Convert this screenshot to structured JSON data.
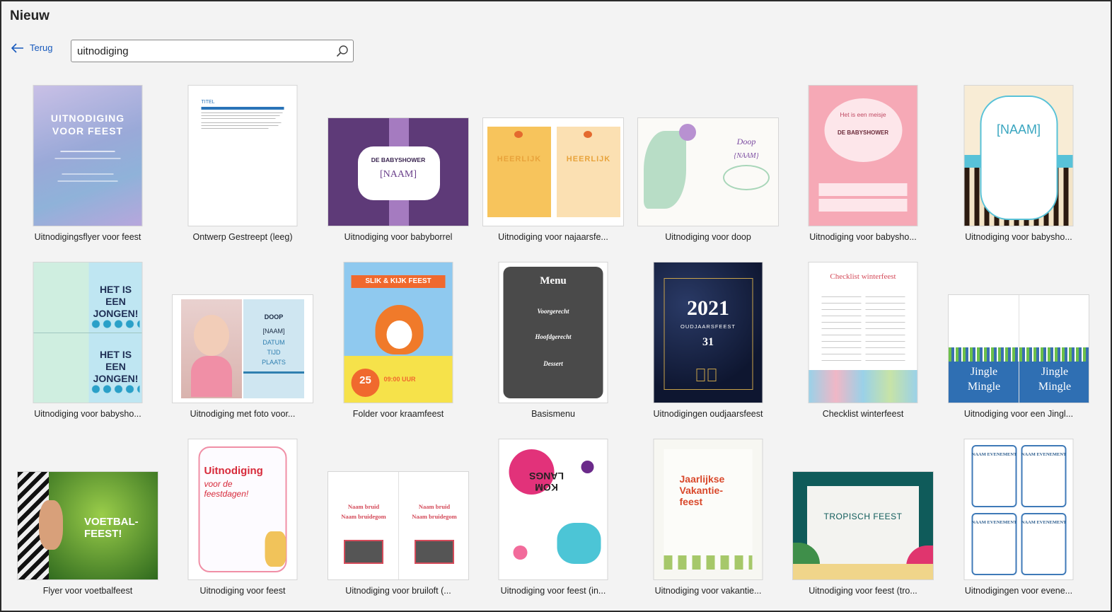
{
  "page": {
    "title": "Nieuw"
  },
  "nav": {
    "back_label": "Terug"
  },
  "search": {
    "value": "uitnodiging",
    "placeholder": ""
  },
  "colors": {
    "accent": "#185abd",
    "background": "#f3f3f3"
  },
  "templates": [
    {
      "label": "Uitnodigingsflyer voor feest",
      "thumb_text": [
        "UITNODIGING",
        "VOOR FEEST"
      ]
    },
    {
      "label": "Ontwerp Gestreept (leeg)",
      "thumb_text": [
        "TITEL"
      ]
    },
    {
      "label": "Uitnodiging voor babyborrel",
      "thumb_text": [
        "DE BABYSHOWER",
        "[NAAM]"
      ]
    },
    {
      "label": "Uitnodiging voor najaarsfe...",
      "thumb_text": [
        "HEERLIJK",
        "HEERLIJK"
      ]
    },
    {
      "label": "Uitnodiging voor doop",
      "thumb_text": [
        "Doop",
        "{NAAM}"
      ]
    },
    {
      "label": "Uitnodiging voor babysho...",
      "thumb_text": [
        "Het is een meisje",
        "DE BABYSHOWER"
      ]
    },
    {
      "label": "Uitnodiging voor babysho...",
      "thumb_text": [
        "[NAAM]"
      ]
    },
    {
      "label": "Uitnodiging voor babysho...",
      "thumb_text": [
        "HET IS EEN JONGEN!",
        "HET IS EEN JONGEN!"
      ]
    },
    {
      "label": "Uitnodiging met foto voor...",
      "thumb_text": [
        "DOOP",
        "[NAAM]",
        "DATUM",
        "TIJD",
        "PLAATS"
      ]
    },
    {
      "label": "Folder voor kraamfeest",
      "thumb_text": [
        "SLIK & KIJK FEEST",
        "25",
        "09:00 UUR"
      ]
    },
    {
      "label": "Basismenu",
      "thumb_text": [
        "Menu",
        "Voorgerecht",
        "Hoofdgerecht",
        "Dessert"
      ]
    },
    {
      "label": "Uitnodigingen oudjaarsfeest",
      "thumb_text": [
        "2021",
        "OUDJAARSFEEST",
        "31"
      ]
    },
    {
      "label": "Checklist winterfeest",
      "thumb_text": [
        "Checklist winterfeest"
      ]
    },
    {
      "label": "Uitnodiging voor een Jingl...",
      "thumb_text": [
        "Jingle Mingle",
        "Jingle Mingle"
      ]
    },
    {
      "label": "Flyer voor voetbalfeest",
      "thumb_text": [
        "VOETBAL-FEEST!"
      ]
    },
    {
      "label": "Uitnodiging voor feest",
      "thumb_text": [
        "Uitnodiging",
        "voor de feestdagen!"
      ]
    },
    {
      "label": "Uitnodiging voor bruiloft (...",
      "thumb_text": [
        "Naam bruid",
        "Naam bruidegom"
      ]
    },
    {
      "label": "Uitnodiging voor feest (in...",
      "thumb_text": [
        "KOM LANGS"
      ]
    },
    {
      "label": "Uitnodiging voor vakantie...",
      "thumb_text": [
        "Jaarlijkse Vakantie-feest"
      ]
    },
    {
      "label": "Uitnodiging voor feest (tro...",
      "thumb_text": [
        "TROPISCH FEEST"
      ]
    },
    {
      "label": "Uitnodigingen voor evene...",
      "thumb_text": [
        "NAAM EVENEMENT"
      ]
    }
  ]
}
